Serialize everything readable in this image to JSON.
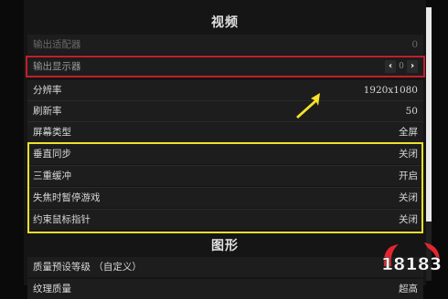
{
  "sections": {
    "video_title": "视频",
    "graphics_title": "图形"
  },
  "settings": [
    {
      "label": "输出适配器",
      "value": "0"
    },
    {
      "label": "输出显示器",
      "value": "0"
    },
    {
      "label": "分辨率",
      "value": "1920x1080"
    },
    {
      "label": "刷新率",
      "value": "50"
    },
    {
      "label": "屏幕类型",
      "value": "全屏"
    },
    {
      "label": "垂直同步",
      "value": "关闭"
    },
    {
      "label": "三重缓冲",
      "value": "开启"
    },
    {
      "label": "失焦时暂停游戏",
      "value": "关闭"
    },
    {
      "label": "约束鼠标指针",
      "value": "关闭"
    }
  ],
  "graphics_settings": [
    {
      "label": "质量预设等级 （自定义）",
      "value": ""
    },
    {
      "label": "纹理质量",
      "value": "超高"
    }
  ],
  "selector": {
    "prev_icon": "chevron-left-icon",
    "next_icon": "chevron-right-icon"
  },
  "watermark": {
    "text": "18183"
  },
  "colors": {
    "highlight_red": "#c21f2a",
    "highlight_yellow": "#f0e02a",
    "arrow_yellow": "#f5e22a",
    "logo_red": "#e3262e"
  }
}
